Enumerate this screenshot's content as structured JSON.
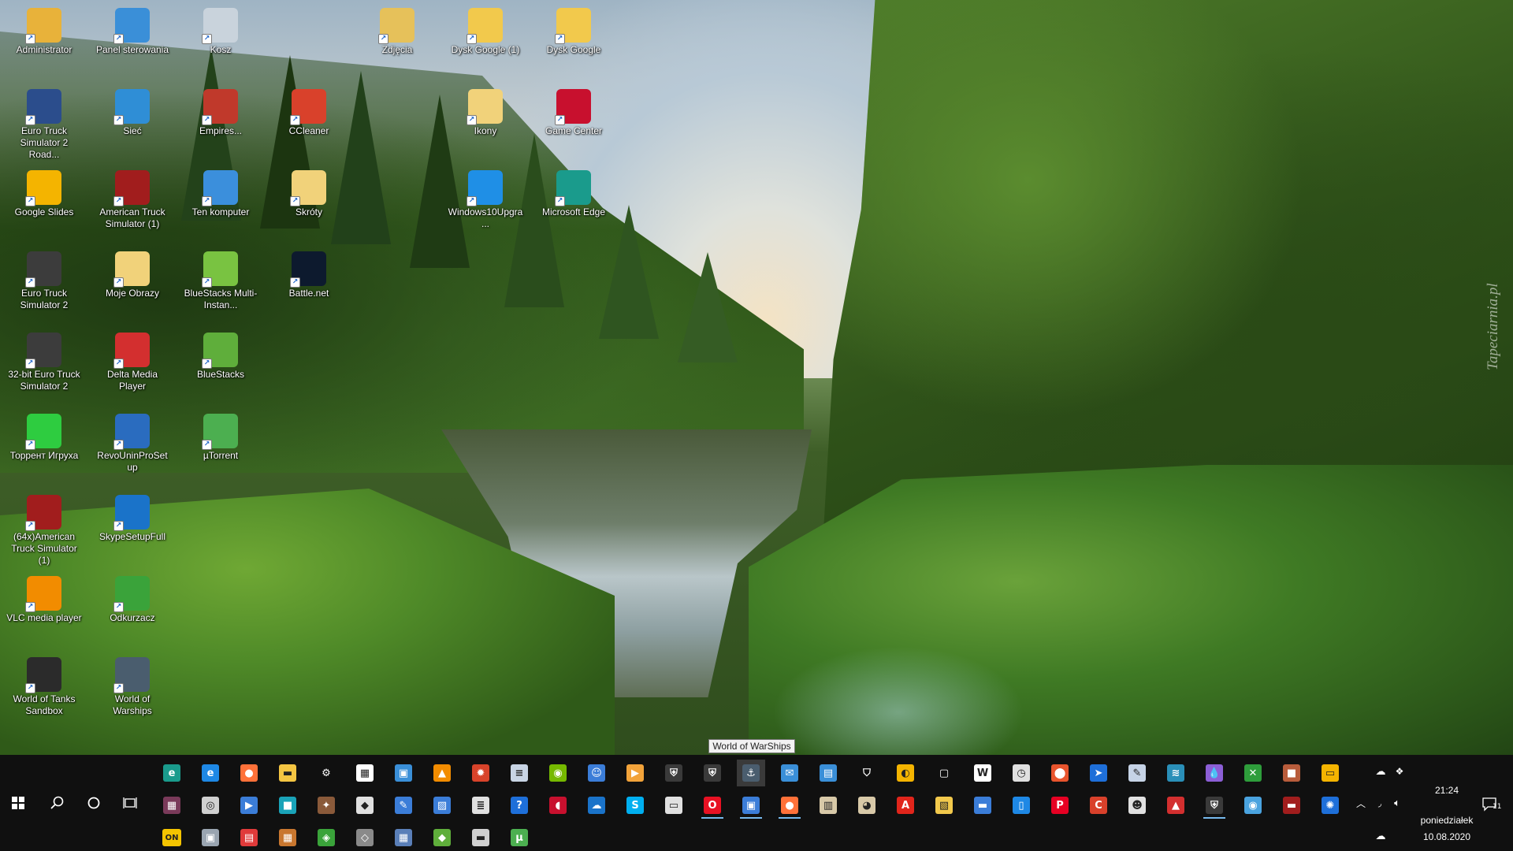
{
  "desktop": {
    "icons": [
      {
        "label": "Administrator",
        "icon": "user-folder-icon",
        "color": "#e8b23a"
      },
      {
        "label": "Panel sterowania",
        "icon": "control-panel-icon",
        "color": "#3a8fd8"
      },
      {
        "label": "Kosz",
        "icon": "recycle-bin-icon",
        "color": "#c9d3dc"
      },
      {
        "label": "Zdjęcia",
        "icon": "folder-photos-icon",
        "color": "#e6c15a"
      },
      {
        "label": "Dysk Google (1)",
        "icon": "google-drive-folder-icon",
        "color": "#f2c94c"
      },
      {
        "label": "Dysk Google",
        "icon": "google-drive-folder-icon",
        "color": "#f2c94c"
      },
      {
        "label": "Euro Truck Simulator 2 Road...",
        "icon": "truck-icon",
        "color": "#2b4d8c"
      },
      {
        "label": "Sieć",
        "icon": "network-icon",
        "color": "#2f8ed6"
      },
      {
        "label": "Empires...",
        "icon": "game-icon",
        "color": "#c0392b"
      },
      {
        "label": "CCleaner",
        "icon": "ccleaner-icon",
        "color": "#d9412b"
      },
      {
        "label": "Ikony",
        "icon": "folder-icon",
        "color": "#f1d27a"
      },
      {
        "label": "Game Center",
        "icon": "game-center-icon",
        "color": "#c8102e"
      },
      {
        "label": "Google Slides",
        "icon": "google-slides-icon",
        "color": "#f4b400"
      },
      {
        "label": "American Truck Simulator (1)",
        "icon": "truck-icon",
        "color": "#a11d1d"
      },
      {
        "label": "Ten komputer",
        "icon": "computer-icon",
        "color": "#3b8fdc"
      },
      {
        "label": "Skróty",
        "icon": "folder-shortcuts-icon",
        "color": "#f1d27a"
      },
      {
        "label": "Windows10Upgra...",
        "icon": "windows-icon",
        "color": "#1f8fe6"
      },
      {
        "label": "Microsoft Edge",
        "icon": "edge-icon",
        "color": "#1a9b8c"
      },
      {
        "label": "Euro Truck Simulator 2",
        "icon": "truck-icon",
        "color": "#3c3c3c"
      },
      {
        "label": "Moje Obrazy",
        "icon": "folder-icon",
        "color": "#f1d27a"
      },
      {
        "label": "BlueStacks Multi-Instan...",
        "icon": "bluestacks-multi-icon",
        "color": "#79c341"
      },
      {
        "label": "Battle.net",
        "icon": "battlenet-icon",
        "color": "#0d1a2e"
      },
      {
        "label": "32-bit Euro Truck Simulator 2",
        "icon": "truck-icon",
        "color": "#3c3c3c"
      },
      {
        "label": "Delta Media Player",
        "icon": "delta-icon",
        "color": "#d32f2f"
      },
      {
        "label": "BlueStacks",
        "icon": "bluestacks-icon",
        "color": "#5fae3b"
      },
      {
        "label": "Торрент Игруха",
        "icon": "torrent-igruha-icon",
        "color": "#2ecc40"
      },
      {
        "label": "RevoUninProSetup",
        "icon": "revo-uninstaller-icon",
        "color": "#2a6cbf"
      },
      {
        "label": "µTorrent",
        "icon": "utorrent-icon",
        "color": "#4caf50"
      },
      {
        "label": "(64x)American Truck Simulator (1)",
        "icon": "truck-icon",
        "color": "#a11d1d"
      },
      {
        "label": "SkypeSetupFull",
        "icon": "zip-icon",
        "color": "#1a73c9"
      },
      {
        "label": "VLC media player",
        "icon": "vlc-icon",
        "color": "#f28c00"
      },
      {
        "label": "Odkurzacz",
        "icon": "cleaner-icon",
        "color": "#3aa33a"
      },
      {
        "label": "World of Tanks Sandbox",
        "icon": "wot-icon",
        "color": "#2b2b2b"
      },
      {
        "label": "World of Warships",
        "icon": "wows-icon",
        "color": "#4a5d6e"
      }
    ],
    "watermark": "Tapeciarnia.pl"
  },
  "taskbar": {
    "tooltip": "World of WarShips",
    "start": {
      "icon": "windows-start-icon"
    },
    "search": {
      "icon": "search-icon"
    },
    "cortana": {
      "icon": "cortana-icon"
    },
    "taskview": {
      "icon": "task-view-icon"
    },
    "row1": [
      {
        "icon": "edge-icon",
        "color": "#1a9b8c",
        "glyph": "e"
      },
      {
        "icon": "internet-explorer-icon",
        "color": "#1e88e5",
        "glyph": "e"
      },
      {
        "icon": "firefox-icon",
        "color": "#ff7139",
        "glyph": "●"
      },
      {
        "icon": "file-explorer-icon",
        "color": "#f4c542",
        "glyph": "▬"
      },
      {
        "icon": "settings-gear-icon",
        "color": "#101010",
        "glyph": "⚙"
      },
      {
        "icon": "store-icon",
        "color": "#ffffff",
        "glyph": "▦"
      },
      {
        "icon": "control-panel-icon",
        "color": "#3a8fd8",
        "glyph": "▣"
      },
      {
        "icon": "vlc-icon",
        "color": "#f28c00",
        "glyph": "▲"
      },
      {
        "icon": "sun-app-icon",
        "color": "#d8432a",
        "glyph": "✹"
      },
      {
        "icon": "document-icon",
        "color": "#c8d4e4",
        "glyph": "≡"
      },
      {
        "icon": "nvidia-icon",
        "color": "#76b900",
        "glyph": "◉"
      },
      {
        "icon": "people-icon",
        "color": "#3b7dd8",
        "glyph": "☺"
      },
      {
        "icon": "media-player-icon",
        "color": "#f2a33a",
        "glyph": "▶"
      },
      {
        "icon": "wot-icon",
        "color": "#3a3a3a",
        "glyph": "⛨"
      },
      {
        "icon": "wot-icon",
        "color": "#3a3a3a",
        "glyph": "⛨"
      },
      {
        "icon": "wows-icon",
        "color": "#4a5d6e",
        "glyph": "⚓"
      },
      {
        "icon": "mail-icon",
        "color": "#3a8fd8",
        "glyph": "✉"
      },
      {
        "icon": "calendar-icon",
        "color": "#3a8fd8",
        "glyph": "▤"
      },
      {
        "icon": "security-shield-icon",
        "color": "#101010",
        "glyph": "⛉"
      },
      {
        "icon": "sticky-notes-icon",
        "color": "#f4b400",
        "glyph": "◐"
      },
      {
        "icon": "square-frame-icon",
        "color": "#101010",
        "glyph": "▢"
      },
      {
        "icon": "word-icon",
        "color": "#ffffff",
        "glyph": "W"
      },
      {
        "icon": "clock-app-icon",
        "color": "#e0e0e0",
        "glyph": "◷"
      },
      {
        "icon": "maps-pin-icon",
        "color": "#e8542d",
        "glyph": "⬤"
      },
      {
        "icon": "arrow-app-icon",
        "color": "#1e6fd9",
        "glyph": "➤"
      },
      {
        "icon": "sign-icon",
        "color": "#c6d3e6",
        "glyph": "✎"
      },
      {
        "icon": "wifi-app-icon",
        "color": "#2a8fb8",
        "glyph": "≋"
      },
      {
        "icon": "paint-drop-icon",
        "color": "#8c5fd6",
        "glyph": "💧"
      },
      {
        "icon": "xbox-icon",
        "color": "#2e9d3b",
        "glyph": "✕"
      },
      {
        "icon": "package-icon",
        "color": "#b85c3b",
        "glyph": "■"
      },
      {
        "icon": "slides-icon",
        "color": "#f4b400",
        "glyph": "▭"
      }
    ],
    "row2": [
      {
        "icon": "film-icon",
        "color": "#7a3a5a",
        "glyph": "▦"
      },
      {
        "icon": "disc-icon",
        "color": "#d0d0d0",
        "glyph": "◎"
      },
      {
        "icon": "play-circle-icon",
        "color": "#3b7dd8",
        "glyph": "▶"
      },
      {
        "icon": "teal-square-icon",
        "color": "#1aa3b8",
        "glyph": "■"
      },
      {
        "icon": "puzzle-icon",
        "color": "#8a5a3a",
        "glyph": "✦"
      },
      {
        "icon": "android-icon",
        "color": "#e0e0e0",
        "glyph": "◆"
      },
      {
        "icon": "paint-icon",
        "color": "#3b7dd8",
        "glyph": "✎"
      },
      {
        "icon": "picture-icon",
        "color": "#3b7dd8",
        "glyph": "▨"
      },
      {
        "icon": "books-icon",
        "color": "#e0e0e0",
        "glyph": "≣"
      },
      {
        "icon": "help-icon",
        "color": "#1e6fd9",
        "glyph": "?"
      },
      {
        "icon": "game-center-icon",
        "color": "#c8102e",
        "glyph": "◖"
      },
      {
        "icon": "onedrive-icon",
        "color": "#1a73c9",
        "glyph": "☁"
      },
      {
        "icon": "skype-icon",
        "color": "#00aff0",
        "glyph": "S"
      },
      {
        "icon": "window-icon",
        "color": "#e0e0e0",
        "glyph": "▭"
      },
      {
        "icon": "opera-icon",
        "color": "#e81123",
        "glyph": "O",
        "active": true
      },
      {
        "icon": "remote-desktop-icon",
        "color": "#3b7dd8",
        "glyph": "▣",
        "active": true
      },
      {
        "icon": "firefox-icon",
        "color": "#ff7139",
        "glyph": "●",
        "active": true
      },
      {
        "icon": "library-icon",
        "color": "#d8c9a8",
        "glyph": "▥"
      },
      {
        "icon": "palette-icon",
        "color": "#d8c9a8",
        "glyph": "◕"
      },
      {
        "icon": "acrobat-icon",
        "color": "#e1251b",
        "glyph": "A"
      },
      {
        "icon": "photo-viewer-icon",
        "color": "#f2c94c",
        "glyph": "▧"
      },
      {
        "icon": "monitor-icon",
        "color": "#3b7dd8",
        "glyph": "▬"
      },
      {
        "icon": "phone-icon",
        "color": "#1e88e5",
        "glyph": "▯"
      },
      {
        "icon": "pinterest-icon",
        "color": "#e60023",
        "glyph": "P"
      },
      {
        "icon": "ccleaner-icon",
        "color": "#d9412b",
        "glyph": "C"
      },
      {
        "icon": "person-add-icon",
        "color": "#e0e0e0",
        "glyph": "☻"
      },
      {
        "icon": "delta-icon",
        "color": "#d32f2f",
        "glyph": "▲"
      },
      {
        "icon": "wot-icon",
        "color": "#3a3a3a",
        "glyph": "⛨",
        "active": true
      },
      {
        "icon": "lightbulb-icon",
        "color": "#4aa3df",
        "glyph": "◉"
      },
      {
        "icon": "truck-icon",
        "color": "#a11d1d",
        "glyph": "▬"
      },
      {
        "icon": "battlenet-icon",
        "color": "#1e6fd9",
        "glyph": "✺"
      }
    ],
    "row3": [
      {
        "icon": "on-badge-icon",
        "color": "#f4c400",
        "glyph": "ON"
      },
      {
        "icon": "remote-pc-icon",
        "color": "#9aa5b1",
        "glyph": "▣"
      },
      {
        "icon": "news-icon",
        "color": "#e03a3a",
        "glyph": "▤"
      },
      {
        "icon": "collage-icon",
        "color": "#c9772f",
        "glyph": "▦"
      },
      {
        "icon": "green-app-icon",
        "color": "#3aa33a",
        "glyph": "◈"
      },
      {
        "icon": "chip-icon",
        "color": "#8a8a8a",
        "glyph": "◇"
      },
      {
        "icon": "calculator-icon",
        "color": "#5a7fb8",
        "glyph": "▦"
      },
      {
        "icon": "bluestacks-icon",
        "color": "#5fae3b",
        "glyph": "◆"
      },
      {
        "icon": "bus-icon",
        "color": "#d0d0d0",
        "glyph": "▬"
      },
      {
        "icon": "utorrent-icon",
        "color": "#4caf50",
        "glyph": "µ"
      }
    ],
    "tray": {
      "onedrive_icon": "cloud-icon",
      "dropbox_icon": "dropbox-icon",
      "overflow_icon": "chevron-up-icon",
      "network_icon": "wifi-icon",
      "volume_icon": "volume-icon",
      "onedrive2_icon": "cloud-icon",
      "time": "21:24",
      "day": "poniedziałek",
      "date": "10.08.2020",
      "notifications_icon": "action-center-icon",
      "notifications_count": "11"
    }
  }
}
